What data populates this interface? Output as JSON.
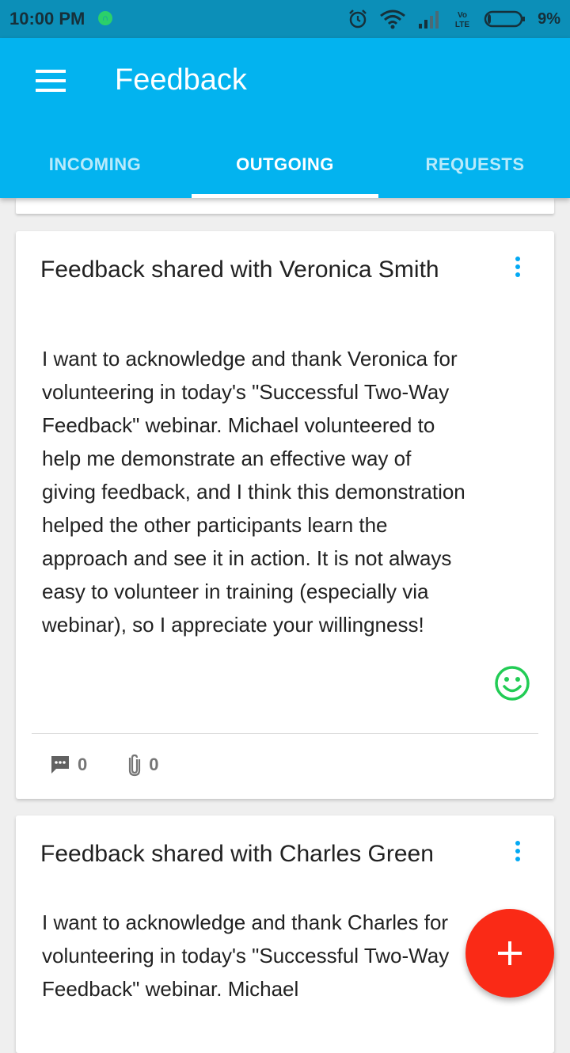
{
  "status_bar": {
    "time": "10:00 PM",
    "battery_percent": "9%",
    "icons": [
      "headset-notification-icon",
      "alarm-icon",
      "wifi-icon",
      "signal-icon",
      "volte-icon",
      "battery-icon"
    ],
    "volte_label_top": "Vo",
    "volte_label_bottom": "LTE",
    "battery_level": 0.09
  },
  "app_bar": {
    "title": "Feedback",
    "menu_icon": "hamburger-menu-icon",
    "background_color": "#03b3ef"
  },
  "tabs": [
    {
      "label": "INCOMING",
      "active": false
    },
    {
      "label": "OUTGOING",
      "active": true
    },
    {
      "label": "REQUESTS",
      "active": false
    }
  ],
  "cards": [
    {
      "title": "Feedback shared with Veronica Smith",
      "body": "I want to acknowledge and thank Veronica for volunteering in today's \"Successful Two-Way Feedback\" webinar. Michael volunteered to help me demonstrate an effective way of giving feedback, and I think this demonstration helped the other participants learn the approach and see it in action. It is not always easy to volunteer in training (especially via webinar), so I appreciate your willingness!",
      "sentiment_icon": "smiley-icon",
      "comments_count": "0",
      "attachments_count": "0"
    },
    {
      "title": "Feedback shared with Charles Green",
      "body": "I want to acknowledge and thank Charles for volunteering in today's \"Successful Two-Way Feedback\" webinar. Michael"
    }
  ],
  "fab": {
    "icon": "plus-icon",
    "color": "#fa2a16"
  },
  "colors": {
    "accent": "#03a9f4",
    "smiley": "#22cc55"
  }
}
